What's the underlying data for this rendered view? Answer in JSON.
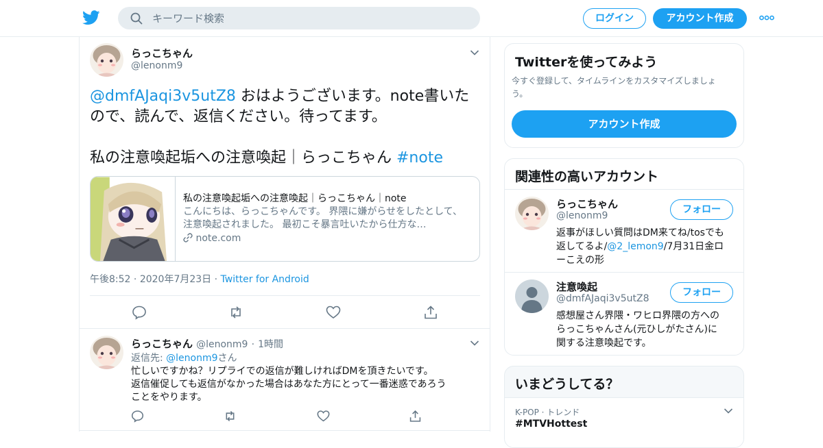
{
  "header": {
    "search_placeholder": "キーワード検索",
    "login_label": "ログイン",
    "signup_label": "アカウント作成"
  },
  "tweet": {
    "author_name": "らっこちゃん",
    "author_handle": "@lenonm9",
    "mention": "@dmfAJaqi3v5utZ8",
    "body_line1": " おはようございます。note書いた",
    "body_line2": "ので、読んで、返信ください。待ってます。",
    "body_line3": "私の注意喚起垢への注意喚起｜らっこちゃん ",
    "hashtag": "#note",
    "card": {
      "title": "私の注意喚起垢への注意喚起｜らっこちゃん｜note",
      "description": "こんにちは、らっこちゃんです。 界隈に嫌がらせをしたとして、注意喚起されました。 最初こそ暴言吐いたから仕方な…",
      "domain": "note.com"
    },
    "time": "午後8:52",
    "date": "2020年7月23日",
    "source": "Twitter for Android"
  },
  "reply": {
    "author_name": "らっこちゃん",
    "author_handle": "@lenonm9",
    "time_ago": "1時間",
    "reply_to_prefix": "返信先: ",
    "reply_to_handle": "@lenonm9",
    "reply_to_suffix": "さん",
    "text_line1": "忙しいですかね？リプライでの返信が難しければDMを頂きたいです。",
    "text_line2": "返信催促しても返信がなかった場合はあなた方にとって一番迷惑であろう",
    "text_line3": "ことをやります。"
  },
  "sidebar": {
    "signup_box": {
      "title": "Twitterを使ってみよう",
      "subtitle_line1": "今すぐ登録して、タイムラインをカスタマイズしましょ",
      "subtitle_line2": "う。",
      "button": "アカウント作成"
    },
    "relevant": {
      "title": "関連性の高いアカウント",
      "follow_label": "フォロー",
      "accounts": [
        {
          "name": "らっこちゃん",
          "handle": "@lenonm9",
          "bio_line1": "返事がほしい質問はDM来てね/tosでも",
          "bio_line2_prefix": "返してるよ/",
          "bio_line2_link": "@2_lemon9",
          "bio_line2_suffix": "/7月31日金ロ",
          "bio_line3": "ーこえの形"
        },
        {
          "name": "注意喚起",
          "handle": "@dmfAJaqi3v5utZ8",
          "bio_line1": "感想屋さん界隈・ワヒロ界隈の方への",
          "bio_line2": "らっこちゃんさん(元ひしがたさん)に",
          "bio_line3": "関する注意喚起です。"
        }
      ]
    },
    "trends": {
      "title": "いまどうしてる？",
      "item_category": "K-POP · トレンド",
      "item_name": "#MTVHottest"
    }
  },
  "colors": {
    "brand": "#1da1f2",
    "link": "#1b95e0",
    "muted": "#657786",
    "border": "#e6ecf0"
  }
}
